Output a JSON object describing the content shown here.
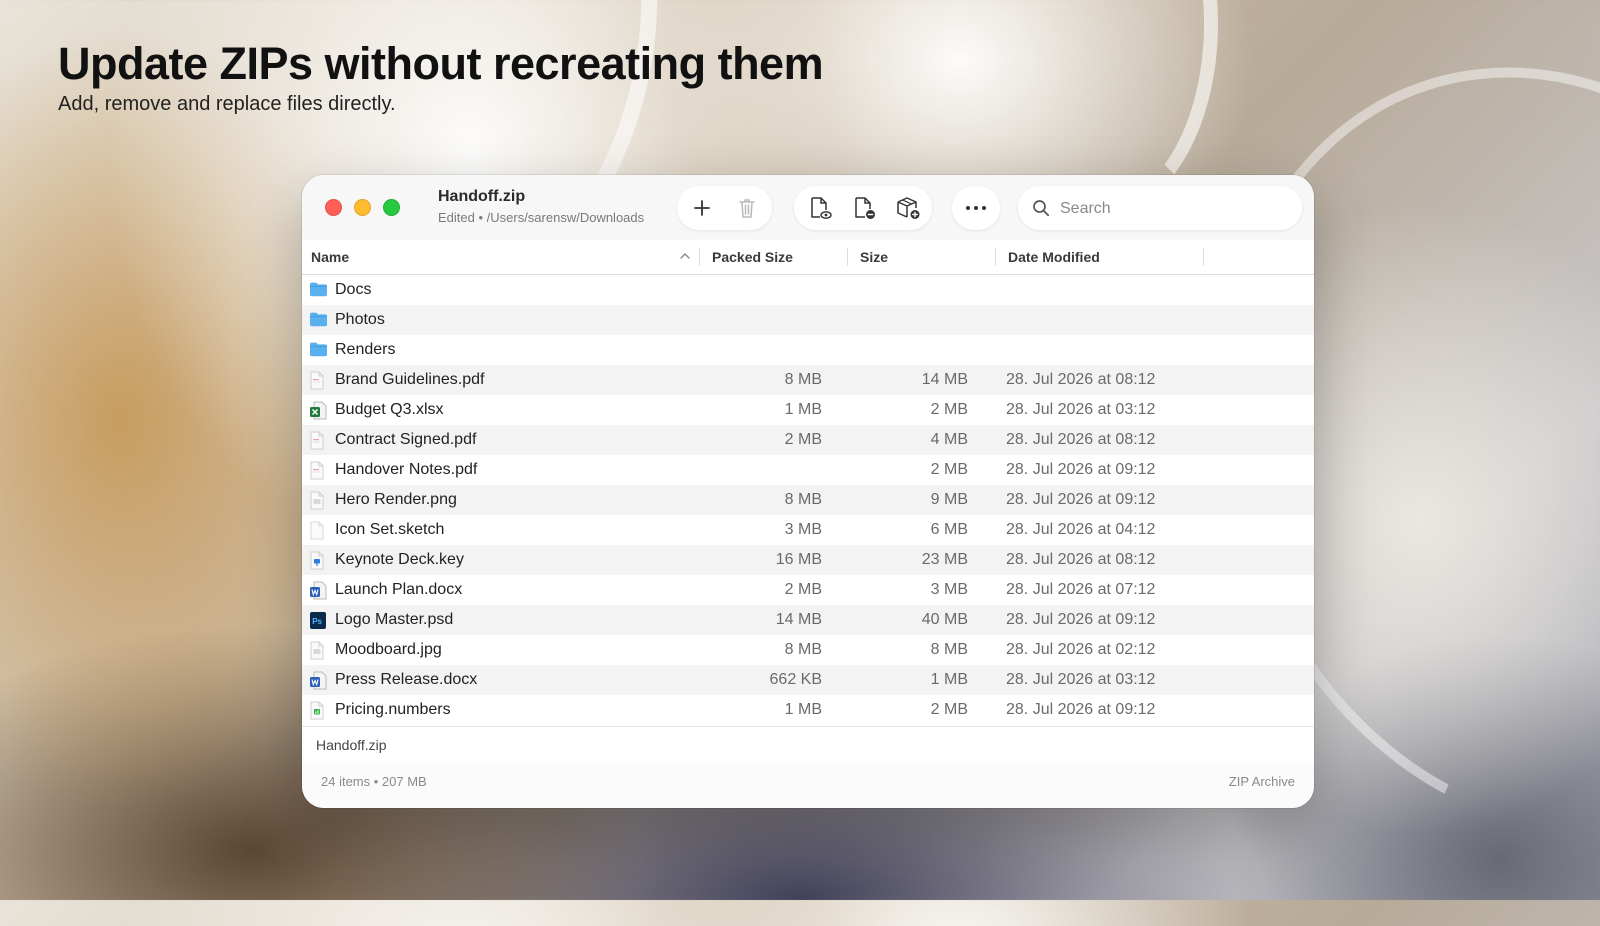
{
  "promo": {
    "headline": "Update ZIPs without recreating them",
    "subheadline": "Add, remove and replace files directly."
  },
  "window": {
    "title": "Handoff.zip",
    "subtitle": "Edited • /Users/sarensw/Downloads",
    "search_placeholder": "Search"
  },
  "colors": {
    "close": "#ff5f57",
    "minimize": "#febc2e",
    "maximize": "#28c840",
    "folder": "#5ab0ef"
  },
  "columns": {
    "name": "Name",
    "packed": "Packed Size",
    "size": "Size",
    "modified": "Date Modified"
  },
  "rows": [
    {
      "name": "Docs",
      "icon": "folder-icon",
      "packed": "",
      "size": "",
      "modified": ""
    },
    {
      "name": "Photos",
      "icon": "folder-icon",
      "packed": "",
      "size": "",
      "modified": ""
    },
    {
      "name": "Renders",
      "icon": "folder-icon",
      "packed": "",
      "size": "",
      "modified": ""
    },
    {
      "name": "Brand Guidelines.pdf",
      "icon": "pdf-file-icon",
      "packed": "8 MB",
      "size": "14 MB",
      "modified": "28. Jul 2026 at 08:12"
    },
    {
      "name": "Budget Q3.xlsx",
      "icon": "excel-file-icon",
      "packed": "1 MB",
      "size": "2 MB",
      "modified": "28. Jul 2026 at 03:12"
    },
    {
      "name": "Contract Signed.pdf",
      "icon": "pdf-file-icon",
      "packed": "2 MB",
      "size": "4 MB",
      "modified": "28. Jul 2026 at 08:12"
    },
    {
      "name": "Handover Notes.pdf",
      "icon": "pdf-file-icon",
      "packed": "",
      "size": "2 MB",
      "modified": "28. Jul 2026 at 09:12"
    },
    {
      "name": "Hero Render.png",
      "icon": "image-file-icon",
      "packed": "8 MB",
      "size": "9 MB",
      "modified": "28. Jul 2026 at 09:12"
    },
    {
      "name": "Icon Set.sketch",
      "icon": "blank-file-icon",
      "packed": "3 MB",
      "size": "6 MB",
      "modified": "28. Jul 2026 at 04:12"
    },
    {
      "name": "Keynote Deck.key",
      "icon": "keynote-file-icon",
      "packed": "16 MB",
      "size": "23 MB",
      "modified": "28. Jul 2026 at 08:12"
    },
    {
      "name": "Launch Plan.docx",
      "icon": "word-file-icon",
      "packed": "2 MB",
      "size": "3 MB",
      "modified": "28. Jul 2026 at 07:12"
    },
    {
      "name": "Logo Master.psd",
      "icon": "photoshop-file-icon",
      "packed": "14 MB",
      "size": "40 MB",
      "modified": "28. Jul 2026 at 09:12"
    },
    {
      "name": "Moodboard.jpg",
      "icon": "image-file-icon",
      "packed": "8 MB",
      "size": "8 MB",
      "modified": "28. Jul 2026 at 02:12"
    },
    {
      "name": "Press Release.docx",
      "icon": "word-file-icon",
      "packed": "662 KB",
      "size": "1 MB",
      "modified": "28. Jul 2026 at 03:12"
    },
    {
      "name": "Pricing.numbers",
      "icon": "numbers-file-icon",
      "packed": "1 MB",
      "size": "2 MB",
      "modified": "28. Jul 2026 at 09:12"
    }
  ],
  "pathbar": {
    "label": "Handoff.zip"
  },
  "status": {
    "summary": "24 items • 207 MB",
    "kind": "ZIP Archive"
  }
}
